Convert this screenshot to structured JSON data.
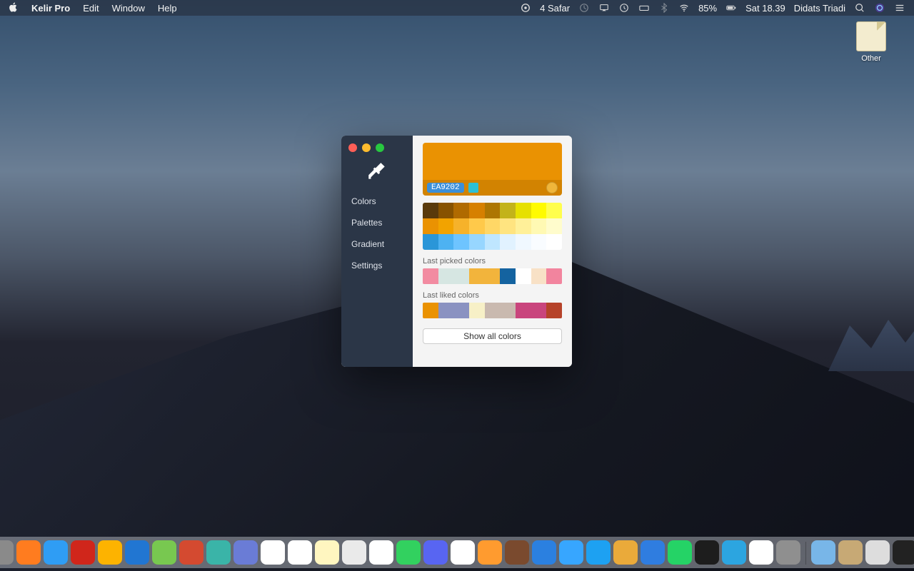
{
  "menubar": {
    "app_name": "Kelir Pro",
    "menus": [
      "Edit",
      "Window",
      "Help"
    ],
    "date_label": "4 Safar",
    "battery": "85%",
    "clock": "Sat 18.39",
    "user": "Didats Triadi"
  },
  "desktop": {
    "other_label": "Other"
  },
  "window": {
    "sidebar": {
      "items": [
        "Colors",
        "Palettes",
        "Gradient",
        "Settings"
      ]
    },
    "preview": {
      "color": "#EA9202",
      "hex_label": "EA9202"
    },
    "swatches_row1": [
      "#5a3a0b",
      "#875200",
      "#b06a00",
      "#d68000",
      "#ad7602",
      "#c3b31a",
      "#e6e000",
      "#fffb00",
      "#fffe4d"
    ],
    "swatches_row2": [
      "#ea9202",
      "#f2a300",
      "#f6b22a",
      "#ffc94a",
      "#ffd766",
      "#ffe480",
      "#fff099",
      "#fff9b3",
      "#fffccc"
    ],
    "swatches_row3": [
      "#2a96d8",
      "#4db2f2",
      "#6ec4ff",
      "#97d6ff",
      "#bfe6ff",
      "#e1f2ff",
      "#f0f8ff",
      "#f9fcff",
      "#ffffff"
    ],
    "last_picked_label": "Last picked colors",
    "last_picked": [
      "#f28ba1",
      "#d6e6e2",
      "#d6e6e2",
      "#f2b43c",
      "#f2b43c",
      "#1463a0",
      "#ffffff",
      "#f8e1c6",
      "#f2849e"
    ],
    "last_liked_label": "Last liked colors",
    "last_liked": [
      "#ea9202",
      "#8a92c1",
      "#8a92c1",
      "#f7f0c7",
      "#c9b9af",
      "#c9b9af",
      "#c9457d",
      "#c9457d",
      "#b6432a"
    ],
    "show_all_label": "Show all colors"
  },
  "dock": {
    "apps": [
      {
        "name": "finder",
        "bg": "#3ba7ff"
      },
      {
        "name": "siri",
        "bg": "#1a1a1a"
      },
      {
        "name": "launchpad",
        "bg": "#8a8a8a"
      },
      {
        "name": "firefox",
        "bg": "#ff7c1f"
      },
      {
        "name": "safari",
        "bg": "#2f9df4"
      },
      {
        "name": "opera",
        "bg": "#d0261b"
      },
      {
        "name": "sketch",
        "bg": "#fdb300"
      },
      {
        "name": "xcode",
        "bg": "#2176d2"
      },
      {
        "name": "notes-green",
        "bg": "#78c850"
      },
      {
        "name": "app-store-red",
        "bg": "#d44a30"
      },
      {
        "name": "mail-teal",
        "bg": "#3ab4a8"
      },
      {
        "name": "app2",
        "bg": "#6a7cd6"
      },
      {
        "name": "calendar",
        "bg": "#ffffff"
      },
      {
        "name": "reminders",
        "bg": "#ffffff"
      },
      {
        "name": "notes",
        "bg": "#fff6c0"
      },
      {
        "name": "maps",
        "bg": "#eaeaea"
      },
      {
        "name": "photos",
        "bg": "#ffffff"
      },
      {
        "name": "messages",
        "bg": "#32d15f"
      },
      {
        "name": "discord",
        "bg": "#5865f2"
      },
      {
        "name": "music",
        "bg": "#ffffff"
      },
      {
        "name": "books",
        "bg": "#ff9b2f"
      },
      {
        "name": "videocast",
        "bg": "#7a4a2e"
      },
      {
        "name": "maps-blue",
        "bg": "#2b80e0"
      },
      {
        "name": "appstore",
        "bg": "#37a6ff"
      },
      {
        "name": "tweet",
        "bg": "#1da1f2"
      },
      {
        "name": "stack",
        "bg": "#eaaa3a"
      },
      {
        "name": "shield",
        "bg": "#2f7de0"
      },
      {
        "name": "whatsapp",
        "bg": "#25d366"
      },
      {
        "name": "terminal",
        "bg": "#1d1d1d"
      },
      {
        "name": "telegram",
        "bg": "#2ca5e0"
      },
      {
        "name": "slack",
        "bg": "#ffffff"
      },
      {
        "name": "settings",
        "bg": "#8f8f8f"
      }
    ],
    "right": [
      {
        "name": "downloads-folder",
        "bg": "#78b6e8"
      },
      {
        "name": "documents-folder",
        "bg": "#c7a975"
      },
      {
        "name": "color-app",
        "bg": "#dddddd"
      },
      {
        "name": "kelir",
        "bg": "#222222"
      }
    ],
    "extra": [
      {
        "name": "textedit",
        "bg": "#ffffff"
      },
      {
        "name": "trash",
        "bg": "#d8d8d8"
      }
    ]
  }
}
